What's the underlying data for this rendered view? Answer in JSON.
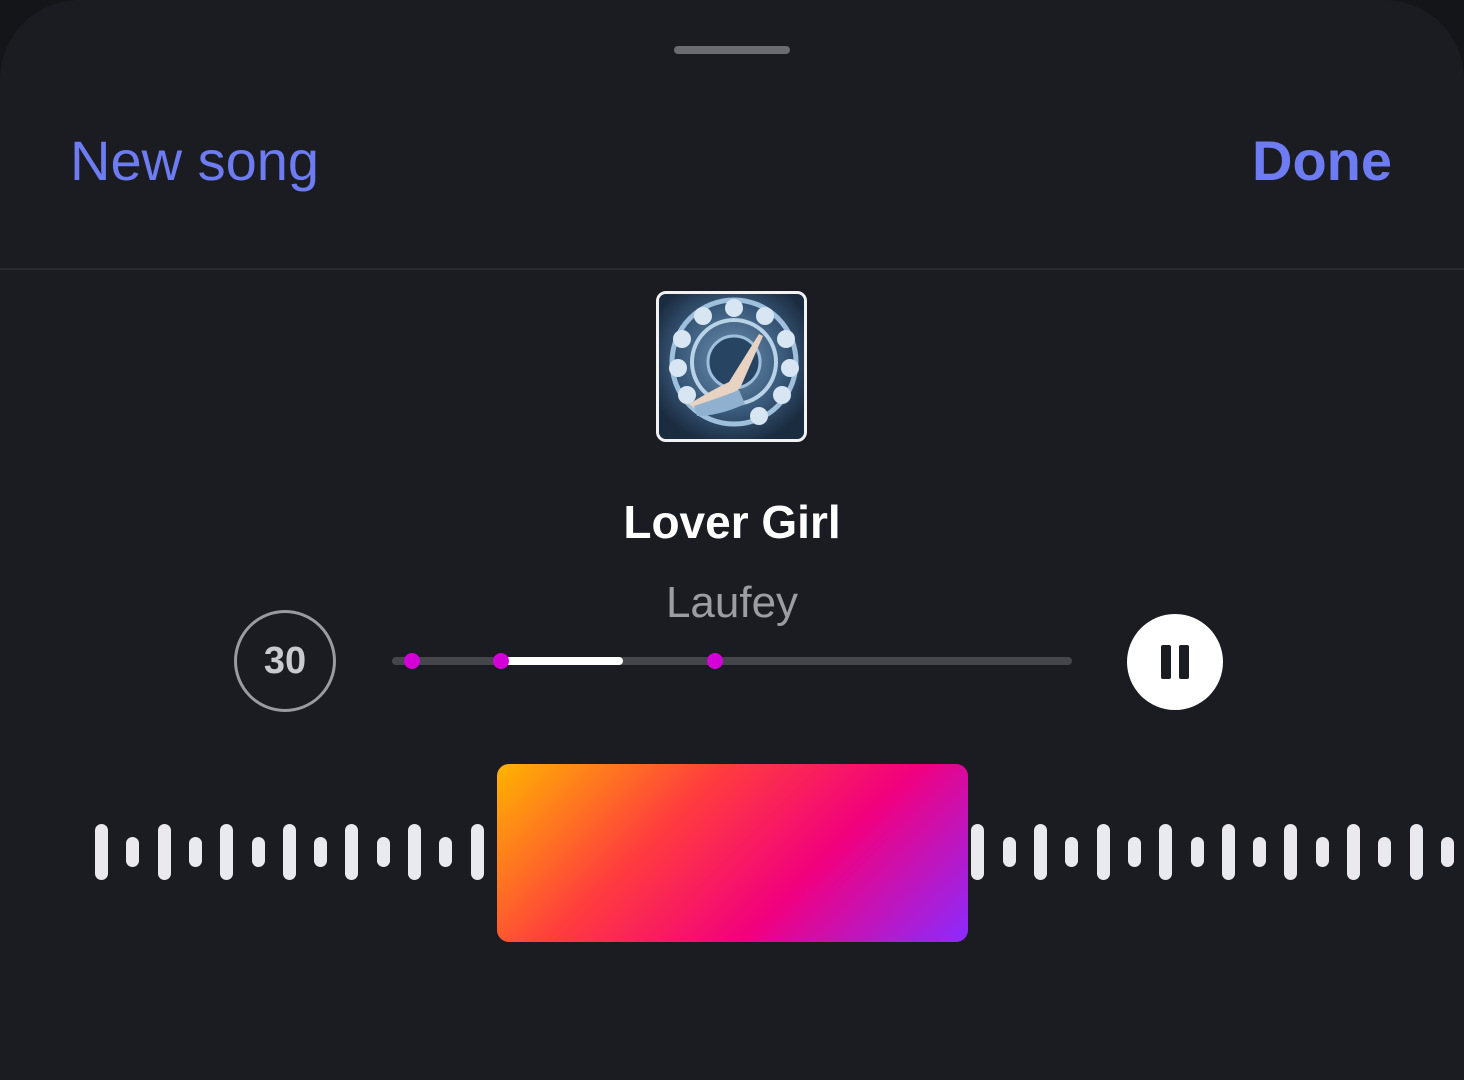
{
  "header": {
    "new_song_label": "New song",
    "done_label": "Done"
  },
  "track": {
    "title": "Lover Girl",
    "artist": "Laufey",
    "cover_icon": "album-cover"
  },
  "player": {
    "duration_label": "30",
    "pause_icon": "pause-icon",
    "progress_start": 0.16,
    "progress_end": 0.34,
    "marker_positions": [
      0.03,
      0.16,
      0.475
    ]
  },
  "colors": {
    "accent": "#6d7cf2",
    "marker": "#d300d8",
    "gradient": [
      "#ffb400",
      "#ff3d3d",
      "#f2007e",
      "#8a2bff"
    ]
  }
}
